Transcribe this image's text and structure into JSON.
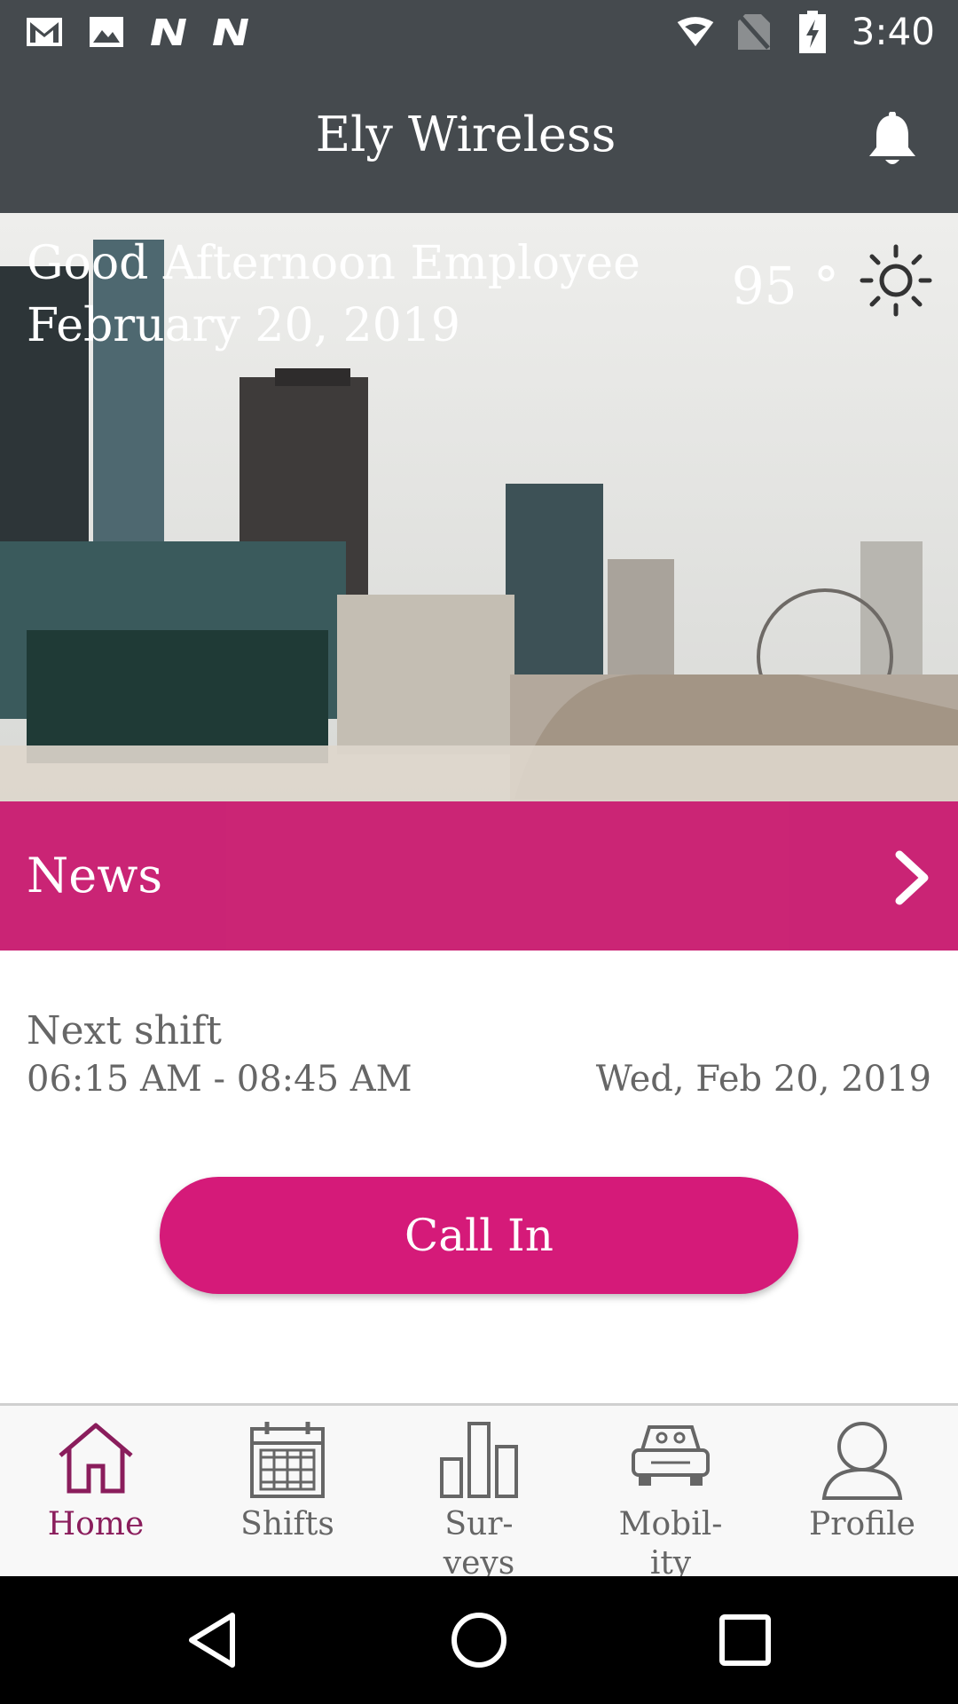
{
  "status_bar": {
    "time": "3:40",
    "left_icons": [
      "gmail-icon",
      "image-icon",
      "n-app-icon",
      "n-app-icon"
    ],
    "right_icons": [
      "wifi-icon",
      "no-sim-icon",
      "battery-charging-icon"
    ]
  },
  "app_bar": {
    "title": "Ely Wireless",
    "notification_icon": "bell-icon"
  },
  "hero": {
    "greeting": "Good Afternoon Employee",
    "date": "February 20, 2019",
    "temperature": "95 °",
    "weather_icon": "sun-icon"
  },
  "news": {
    "label": "News",
    "icon": "chevron-right-icon",
    "color": "#c8196e"
  },
  "next_shift": {
    "label": "Next shift",
    "time_range": "06:15 AM - 08:45 AM",
    "date": "Wed, Feb 20, 2019"
  },
  "call_in": {
    "label": "Call In",
    "color": "#d51a79"
  },
  "tabs": [
    {
      "label": "Home",
      "icon": "home-icon",
      "active": true
    },
    {
      "label": "Shifts",
      "icon": "calendar-icon",
      "active": false
    },
    {
      "label": "Sur-\nveys",
      "icon": "bar-chart-icon",
      "active": false
    },
    {
      "label": "Mobil-\nity",
      "icon": "car-icon",
      "active": false
    },
    {
      "label": "Profile",
      "icon": "person-icon",
      "active": false
    }
  ],
  "nav_bar": {
    "buttons": [
      "back-icon",
      "home-circle-icon",
      "recents-icon"
    ]
  }
}
